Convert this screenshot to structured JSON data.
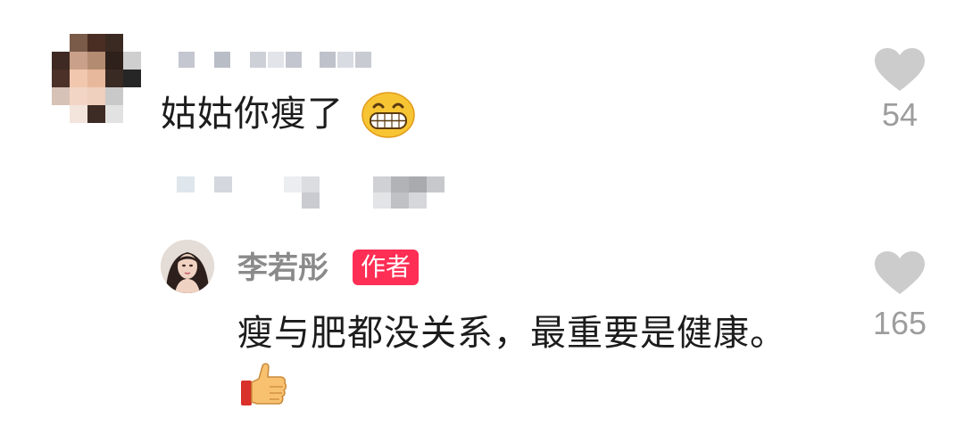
{
  "comment": {
    "author_name": "",
    "text": "姑姑你瘦了",
    "emoji": "grinning-face-with-smiling-eyes",
    "likes": "54"
  },
  "reply": {
    "author_name": "李若彤",
    "badge": "作者",
    "text": "瘦与肥都没关系，最重要是健康。",
    "emoji": "thumbs-up",
    "likes": "165"
  },
  "colors": {
    "badge_bg": "#ff2e55",
    "text_primary": "#1c1c1c",
    "text_secondary": "#8a8a8a",
    "like_icon": "#cccccc"
  }
}
